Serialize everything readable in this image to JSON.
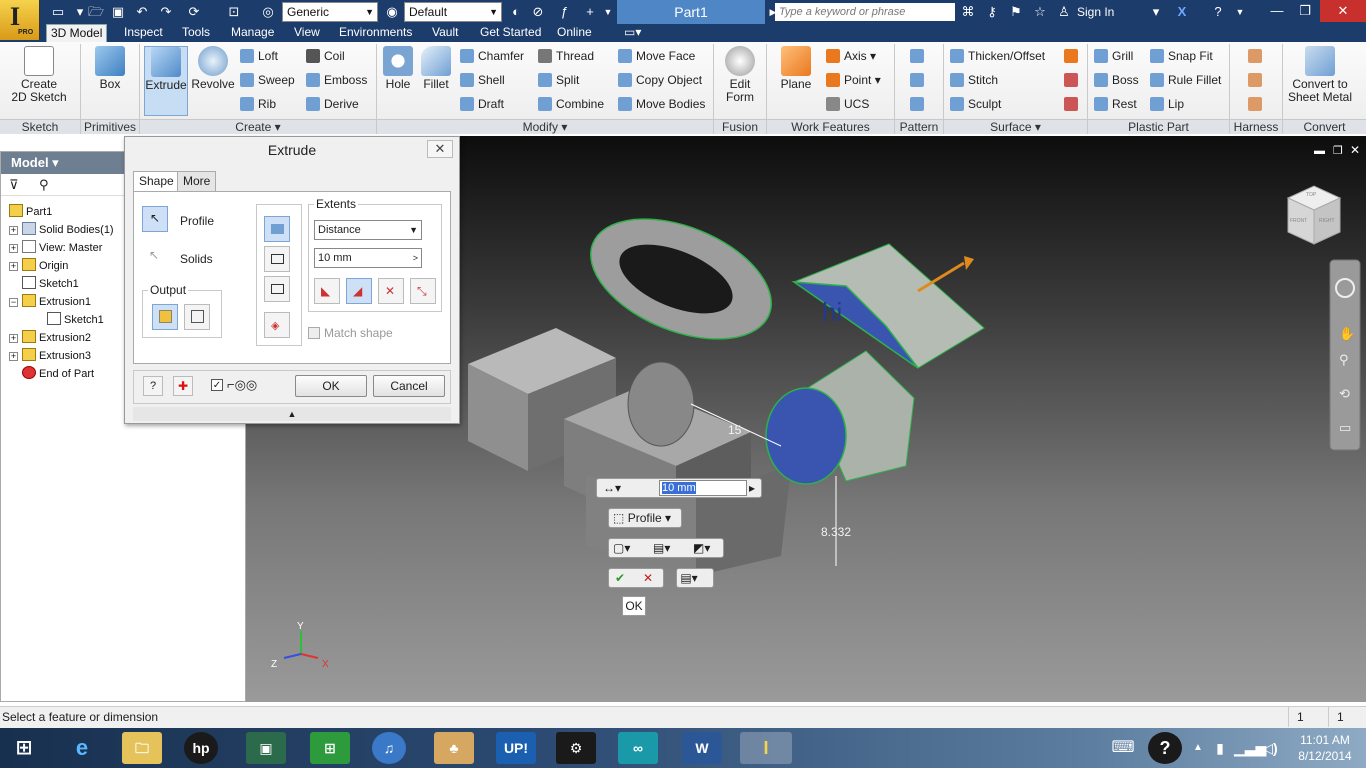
{
  "app": {
    "logo_badge": "PRO",
    "document_title": "Part1",
    "material_combo": "Generic",
    "appearance_combo": "Default",
    "search_placeholder": "Type a keyword or phrase",
    "sign_in": "Sign In"
  },
  "tabs": [
    "3D Model",
    "Inspect",
    "Tools",
    "Manage",
    "View",
    "Environments",
    "Vault",
    "Get Started",
    "Online"
  ],
  "ribbon": {
    "sketch": {
      "label": "Sketch",
      "create_sketch": "Create\n2D Sketch"
    },
    "primitives": {
      "label": "Primitives",
      "box": "Box"
    },
    "create": {
      "label": "Create",
      "extrude": "Extrude",
      "revolve": "Revolve",
      "loft": "Loft",
      "sweep": "Sweep",
      "rib": "Rib",
      "coil": "Coil",
      "emboss": "Emboss",
      "derive": "Derive"
    },
    "modify": {
      "label": "Modify",
      "hole": "Hole",
      "fillet": "Fillet",
      "chamfer": "Chamfer",
      "shell": "Shell",
      "draft": "Draft",
      "thread": "Thread",
      "split": "Split",
      "combine": "Combine",
      "move_face": "Move Face",
      "copy_object": "Copy Object",
      "move_bodies": "Move Bodies"
    },
    "fusion": {
      "label": "Fusion",
      "edit_form": "Edit\nForm"
    },
    "work_features": {
      "label": "Work Features",
      "plane": "Plane",
      "axis": "Axis",
      "point": "Point",
      "ucs": "UCS"
    },
    "pattern": {
      "label": "Pattern"
    },
    "surface": {
      "label": "Surface",
      "thicken": "Thicken/Offset",
      "stitch": "Stitch",
      "sculpt": "Sculpt"
    },
    "plastic_part": {
      "label": "Plastic Part",
      "grill": "Grill",
      "boss": "Boss",
      "rest": "Rest",
      "snap_fit": "Snap Fit",
      "rule_fillet": "Rule Fillet",
      "lip": "Lip"
    },
    "harness": {
      "label": "Harness"
    },
    "convert": {
      "label": "Convert",
      "sheet_metal": "Convert to\nSheet Metal"
    }
  },
  "browser": {
    "title": "Model",
    "items": [
      {
        "label": "Part1"
      },
      {
        "label": "Solid Bodies(1)"
      },
      {
        "label": "View: Master"
      },
      {
        "label": "Origin"
      },
      {
        "label": "Sketch1"
      },
      {
        "label": "Extrusion1"
      },
      {
        "label": "Sketch1"
      },
      {
        "label": "Extrusion2"
      },
      {
        "label": "Extrusion3"
      },
      {
        "label": "End of Part"
      }
    ]
  },
  "dialog": {
    "title": "Extrude",
    "tab_shape": "Shape",
    "tab_more": "More",
    "profile": "Profile",
    "solids": "Solids",
    "output": "Output",
    "extents": "Extents",
    "extents_type": "Distance",
    "distance": "10 mm",
    "match_shape": "Match shape",
    "ok": "OK",
    "cancel": "Cancel"
  },
  "viewport": {
    "sketch_text": "hi",
    "dim_1": "15",
    "dim_2": "8.332",
    "mini_value": "10 mm",
    "mini_profile": "Profile",
    "mini_ok": "OK",
    "axis_x": "X",
    "axis_y": "Y",
    "axis_z": "Z",
    "viewcube_front": "FRONT",
    "viewcube_right": "RIGHT",
    "viewcube_top": "TOP"
  },
  "status": {
    "message": "Select a feature or dimension",
    "count_a": "1",
    "count_b": "1"
  },
  "taskbar": {
    "time": "11:01 AM",
    "date": "8/12/2014",
    "hp": "hp",
    "up": "UP!"
  }
}
